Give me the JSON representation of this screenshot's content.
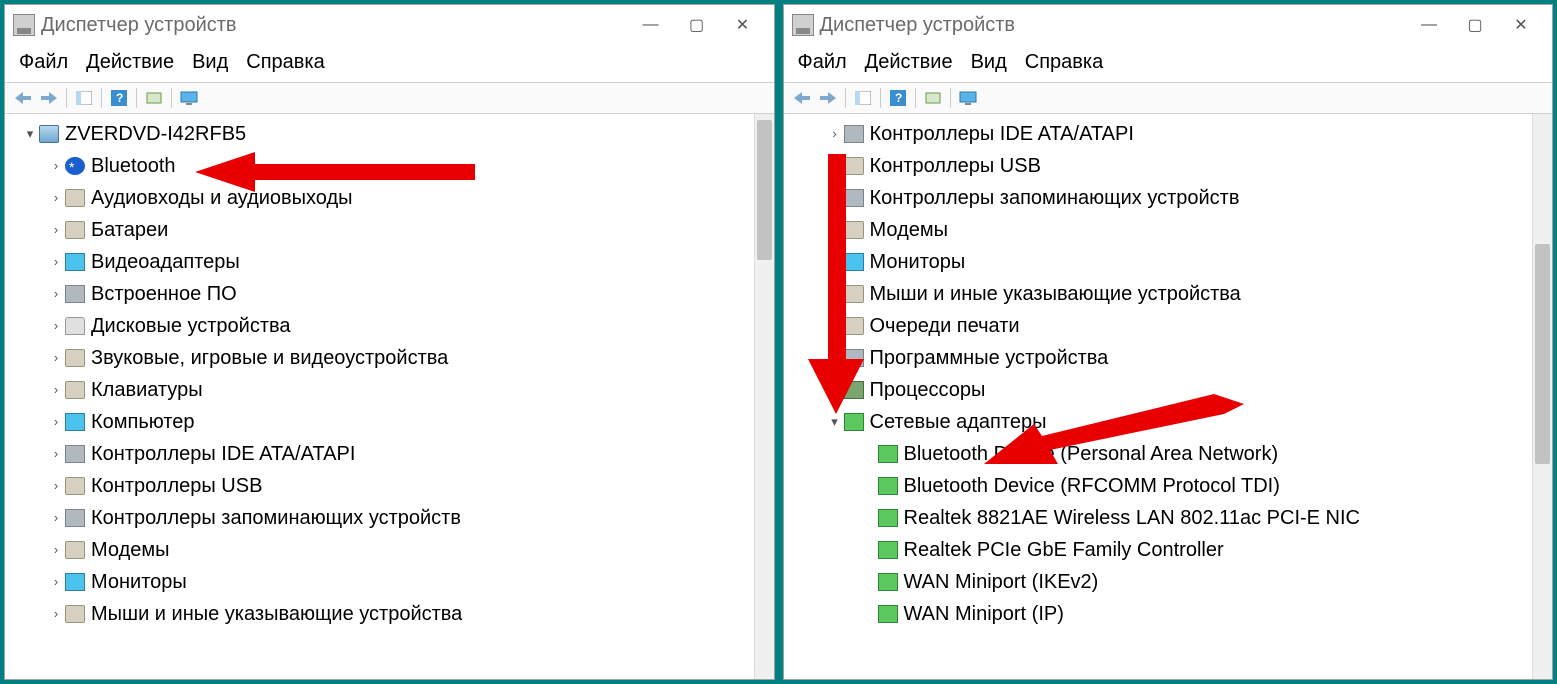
{
  "title": "Диспетчер устройств",
  "menu": {
    "file": "Файл",
    "action": "Действие",
    "view": "Вид",
    "help": "Справка"
  },
  "left": {
    "root": "ZVERDVD-I42RFB5",
    "items": [
      {
        "label": "Bluetooth",
        "icon": "ic-bt"
      },
      {
        "label": "Аудиовходы и аудиовыходы",
        "icon": "ic-generic"
      },
      {
        "label": "Батареи",
        "icon": "ic-generic"
      },
      {
        "label": "Видеоадаптеры",
        "icon": "ic-monitor"
      },
      {
        "label": "Встроенное ПО",
        "icon": "ic-board"
      },
      {
        "label": "Дисковые устройства",
        "icon": "ic-disk"
      },
      {
        "label": "Звуковые, игровые и видеоустройства",
        "icon": "ic-generic"
      },
      {
        "label": "Клавиатуры",
        "icon": "ic-generic"
      },
      {
        "label": "Компьютер",
        "icon": "ic-monitor"
      },
      {
        "label": "Контроллеры IDE ATA/ATAPI",
        "icon": "ic-board"
      },
      {
        "label": "Контроллеры USB",
        "icon": "ic-generic"
      },
      {
        "label": "Контроллеры запоминающих устройств",
        "icon": "ic-board"
      },
      {
        "label": "Модемы",
        "icon": "ic-generic"
      },
      {
        "label": "Мониторы",
        "icon": "ic-monitor"
      },
      {
        "label": "Мыши и иные указывающие устройства",
        "icon": "ic-generic"
      }
    ]
  },
  "right": {
    "items_top": [
      {
        "label": "Контроллеры IDE ATA/ATAPI",
        "icon": "ic-board"
      },
      {
        "label": "Контроллеры USB",
        "icon": "ic-generic"
      },
      {
        "label": "Контроллеры запоминающих устройств",
        "icon": "ic-board"
      },
      {
        "label": "Модемы",
        "icon": "ic-generic"
      },
      {
        "label": "Мониторы",
        "icon": "ic-monitor"
      },
      {
        "label": "Мыши и иные указывающие устройства",
        "icon": "ic-generic"
      },
      {
        "label": "Очереди печати",
        "icon": "ic-generic"
      },
      {
        "label": "Программные устройства",
        "icon": "ic-board"
      },
      {
        "label": "Процессоры",
        "icon": "ic-cpu"
      }
    ],
    "expanded": "Сетевые адаптеры",
    "children": [
      "Bluetooth Device (Personal Area Network)",
      "Bluetooth Device (RFCOMM Protocol TDI)",
      "Realtek 8821AE Wireless LAN 802.11ac PCI-E NIC",
      "Realtek PCIe GbE Family Controller",
      "WAN Miniport (IKEv2)",
      "WAN Miniport (IP)"
    ]
  }
}
